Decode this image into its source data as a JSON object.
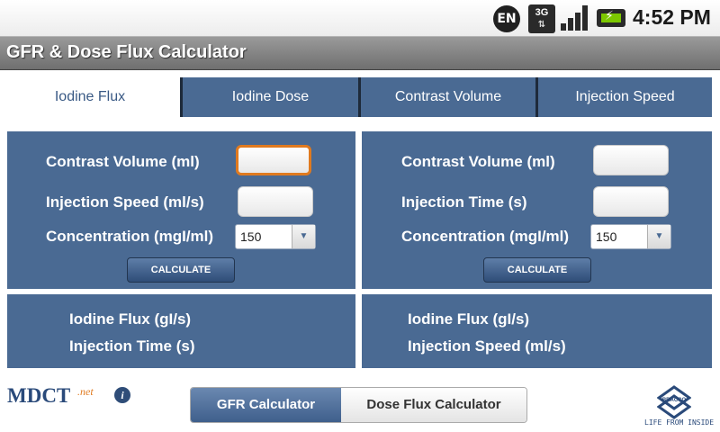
{
  "status_bar": {
    "lang": "EN",
    "network": "3G",
    "time": "4:52 PM"
  },
  "app": {
    "title": "GFR & Dose Flux Calculator"
  },
  "tabs": [
    {
      "label": "Iodine Flux",
      "active": true
    },
    {
      "label": "Iodine Dose",
      "active": false
    },
    {
      "label": "Contrast Volume",
      "active": false
    },
    {
      "label": "Injection Speed",
      "active": false
    }
  ],
  "left_panel": {
    "fields": [
      {
        "label": "Contrast Volume (ml)",
        "value": ""
      },
      {
        "label": "Injection Speed (ml/s)",
        "value": ""
      }
    ],
    "concentration_label": "Concentration (mgI/ml)",
    "concentration_value": "150",
    "calculate_label": "CALCULATE",
    "results": [
      {
        "label": "Iodine Flux (gI/s)"
      },
      {
        "label": "Injection Time (s)"
      }
    ]
  },
  "right_panel": {
    "fields": [
      {
        "label": "Contrast Volume (ml)",
        "value": ""
      },
      {
        "label": "Injection Time (s)",
        "value": ""
      }
    ],
    "concentration_label": "Concentration (mgI/ml)",
    "concentration_value": "150",
    "calculate_label": "CALCULATE",
    "results": [
      {
        "label": "Iodine Flux (gI/s)"
      },
      {
        "label": "Injection Speed (ml/s)"
      }
    ]
  },
  "footer": {
    "logo": "MDCT",
    "logo_suffix": ".net",
    "segments": [
      {
        "label": "GFR Calculator",
        "selected": true
      },
      {
        "label": "Dose Flux Calculator",
        "selected": false
      }
    ],
    "sponsor": "BRACCO",
    "sponsor_tagline": "LIFE FROM INSIDE"
  },
  "colors": {
    "panel_blue": "#4a6a93",
    "focus_orange": "#e07a1f"
  }
}
